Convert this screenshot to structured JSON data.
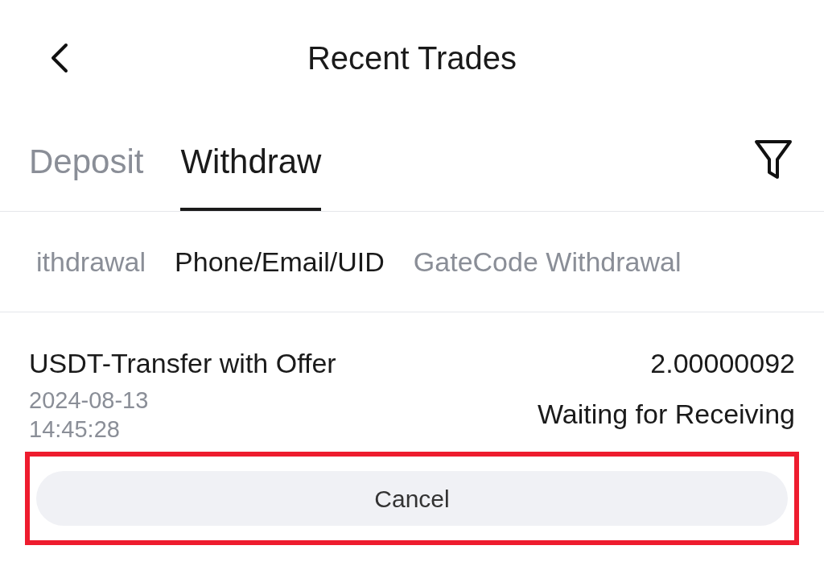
{
  "header": {
    "title": "Recent Trades"
  },
  "tabs": [
    {
      "label": "Deposit",
      "selected": false
    },
    {
      "label": "Withdraw",
      "selected": true
    }
  ],
  "subtabs": [
    {
      "label": "ithdrawal",
      "selected": false
    },
    {
      "label": "Phone/Email/UID",
      "selected": true
    },
    {
      "label": "GateCode Withdrawal",
      "selected": false
    }
  ],
  "record": {
    "title": "USDT-Transfer with Offer",
    "amount": "2.00000092",
    "date": "2024-08-13",
    "time": "14:45:28",
    "status": "Waiting for Receiving",
    "action": "Cancel",
    "highlighted": true
  }
}
